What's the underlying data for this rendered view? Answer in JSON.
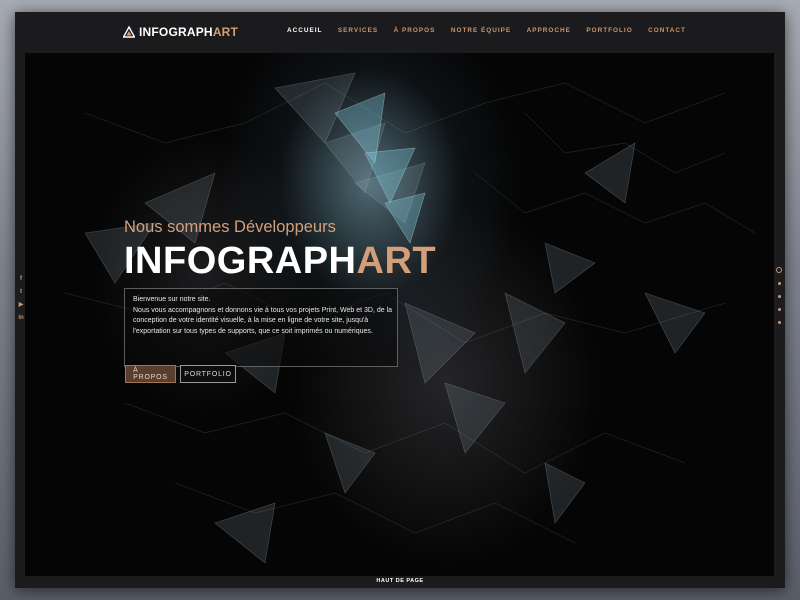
{
  "brand": {
    "name_main": "INFOGRAPH",
    "name_accent": "ART"
  },
  "nav": {
    "items": [
      {
        "label": "ACCUEIL",
        "active": true
      },
      {
        "label": "SERVICES",
        "active": false
      },
      {
        "label": "À PROPOS",
        "active": false
      },
      {
        "label": "NOTRE ÉQUIPE",
        "active": false
      },
      {
        "label": "APPROCHE",
        "active": false
      },
      {
        "label": "PORTFOLIO",
        "active": false
      },
      {
        "label": "CONTACT",
        "active": false
      }
    ]
  },
  "hero": {
    "subtitle": "Nous sommes Développeurs",
    "title_main": "INFOGRAPH",
    "title_accent": "ART",
    "welcome_line1": "Bienvenue sur notre site.",
    "welcome_body": "Nous vous accompagnons et donnons vie à tous vos projets Print, Web et 3D, de la conception de votre identité visuelle, à la mise en ligne de votre site, jusqu'à l'exportation sur tous types de supports, que ce soit imprimés ou numériques.",
    "buttons": {
      "about": "À PROPOS",
      "portfolio": "PORTFOLIO"
    }
  },
  "social": {
    "icons": [
      {
        "name": "facebook-icon",
        "glyph": "f"
      },
      {
        "name": "twitter-icon",
        "glyph": "t"
      },
      {
        "name": "youtube-icon",
        "glyph": "▶"
      },
      {
        "name": "linkedin-icon",
        "glyph": "in"
      }
    ]
  },
  "section_dots": {
    "count": 5,
    "active_index": 0
  },
  "footer": {
    "back_to_top": "HAUT DE PAGE"
  },
  "colors": {
    "accent": "#d39f78",
    "background": "#1c1c1e",
    "hero": "#050505"
  }
}
